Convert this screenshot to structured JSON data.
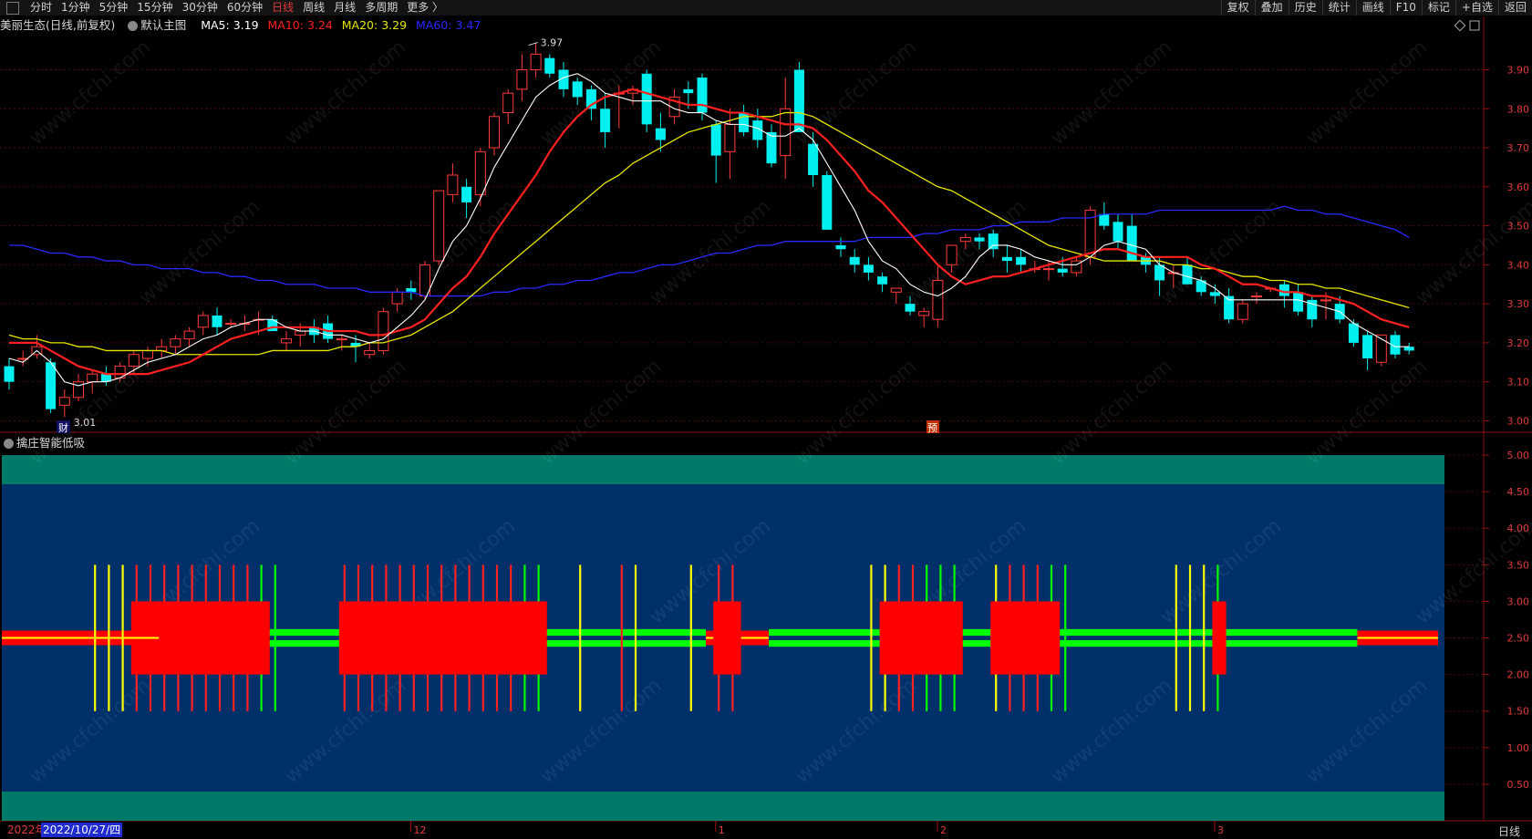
{
  "toolbar": {
    "periods": [
      "分时",
      "1分钟",
      "5分钟",
      "15分钟",
      "30分钟",
      "60分钟",
      "日线",
      "周线",
      "月线",
      "多周期",
      "更多 〉"
    ],
    "active_period": "日线",
    "right_buttons": [
      "复权",
      "叠加",
      "历史",
      "统计",
      "画线",
      "F10",
      "标记",
      "+自选",
      "返回"
    ]
  },
  "info": {
    "stock": "美丽生态(日线,前复权)",
    "template": "默认主图",
    "ma5": "MA5: 3.19",
    "ma10": "MA10: 3.24",
    "ma20": "MA20: 3.29",
    "ma60": "MA60: 3.47",
    "colors": {
      "ma5": "#ffffff",
      "ma10": "#ff2020",
      "ma20": "#e6e600",
      "ma60": "#2020ff"
    }
  },
  "indicator": {
    "title": "擒庄智能低吸"
  },
  "annotations": {
    "high": "3.97",
    "low": "3.01",
    "fin_marker": "财",
    "pre_marker": "预"
  },
  "price_axis": [
    "3.90",
    "3.80",
    "3.70",
    "3.60",
    "3.50",
    "3.40",
    "3.30",
    "3.20",
    "3.10",
    "3.00"
  ],
  "ind_axis": [
    "5.00",
    "4.50",
    "4.00",
    "3.50",
    "3.00",
    "2.50",
    "2.00",
    "1.50",
    "1.00",
    "0.50"
  ],
  "time_axis": {
    "year": "2022年",
    "cursor_date": "2022/10/27/四",
    "months": [
      "12",
      "1",
      "2",
      "3"
    ],
    "period": "日线"
  },
  "watermark": "www.cfchi.com",
  "chart_data": {
    "type": "candlestick",
    "ylim": [
      2.98,
      3.99
    ],
    "indicator_ylim": [
      0,
      5.3
    ],
    "candles": [
      [
        3.14,
        3.16,
        3.08,
        3.1
      ],
      [
        3.16,
        3.18,
        3.14,
        3.16
      ],
      [
        3.17,
        3.22,
        3.16,
        3.19
      ],
      [
        3.15,
        3.16,
        3.02,
        3.03
      ],
      [
        3.04,
        3.08,
        3.01,
        3.06
      ],
      [
        3.06,
        3.12,
        3.05,
        3.1
      ],
      [
        3.1,
        3.13,
        3.07,
        3.12
      ],
      [
        3.12,
        3.14,
        3.09,
        3.1
      ],
      [
        3.11,
        3.15,
        3.1,
        3.14
      ],
      [
        3.14,
        3.18,
        3.12,
        3.17
      ],
      [
        3.16,
        3.19,
        3.14,
        3.18
      ],
      [
        3.18,
        3.21,
        3.16,
        3.19
      ],
      [
        3.19,
        3.22,
        3.17,
        3.21
      ],
      [
        3.21,
        3.24,
        3.19,
        3.23
      ],
      [
        3.24,
        3.28,
        3.22,
        3.27
      ],
      [
        3.27,
        3.29,
        3.22,
        3.24
      ],
      [
        3.25,
        3.26,
        3.24,
        3.25
      ],
      [
        3.25,
        3.27,
        3.23,
        3.25
      ],
      [
        3.26,
        3.28,
        3.22,
        3.26
      ],
      [
        3.26,
        3.27,
        3.23,
        3.23
      ],
      [
        3.2,
        3.23,
        3.18,
        3.21
      ],
      [
        3.22,
        3.25,
        3.19,
        3.23
      ],
      [
        3.24,
        3.26,
        3.2,
        3.22
      ],
      [
        3.25,
        3.27,
        3.2,
        3.21
      ],
      [
        3.21,
        3.22,
        3.18,
        3.21
      ],
      [
        3.2,
        3.22,
        3.15,
        3.19
      ],
      [
        3.17,
        3.2,
        3.16,
        3.18
      ],
      [
        3.18,
        3.29,
        3.17,
        3.28
      ],
      [
        3.3,
        3.34,
        3.28,
        3.33
      ],
      [
        3.34,
        3.36,
        3.31,
        3.33
      ],
      [
        3.32,
        3.41,
        3.31,
        3.4
      ],
      [
        3.41,
        3.59,
        3.4,
        3.59
      ],
      [
        3.58,
        3.66,
        3.56,
        3.63
      ],
      [
        3.6,
        3.62,
        3.52,
        3.56
      ],
      [
        3.58,
        3.7,
        3.55,
        3.69
      ],
      [
        3.7,
        3.79,
        3.68,
        3.78
      ],
      [
        3.79,
        3.85,
        3.76,
        3.84
      ],
      [
        3.85,
        3.94,
        3.82,
        3.9
      ],
      [
        3.9,
        3.97,
        3.88,
        3.94
      ],
      [
        3.93,
        3.94,
        3.88,
        3.89
      ],
      [
        3.9,
        3.92,
        3.83,
        3.85
      ],
      [
        3.87,
        3.88,
        3.81,
        3.83
      ],
      [
        3.85,
        3.86,
        3.77,
        3.8
      ],
      [
        3.8,
        3.84,
        3.7,
        3.74
      ],
      [
        3.84,
        3.86,
        3.75,
        3.84
      ],
      [
        3.84,
        3.86,
        3.81,
        3.85
      ],
      [
        3.89,
        3.9,
        3.74,
        3.76
      ],
      [
        3.75,
        3.79,
        3.69,
        3.72
      ],
      [
        3.78,
        3.85,
        3.76,
        3.83
      ],
      [
        3.85,
        3.87,
        3.8,
        3.84
      ],
      [
        3.88,
        3.89,
        3.77,
        3.79
      ],
      [
        3.76,
        3.77,
        3.61,
        3.68
      ],
      [
        3.69,
        3.8,
        3.62,
        3.76
      ],
      [
        3.79,
        3.81,
        3.73,
        3.74
      ],
      [
        3.77,
        3.8,
        3.7,
        3.72
      ],
      [
        3.74,
        3.76,
        3.65,
        3.66
      ],
      [
        3.68,
        3.88,
        3.62,
        3.8
      ],
      [
        3.9,
        3.92,
        3.74,
        3.74
      ],
      [
        3.71,
        3.74,
        3.6,
        3.63
      ],
      [
        3.63,
        3.64,
        3.5,
        3.49
      ],
      [
        3.45,
        3.47,
        3.42,
        3.44
      ],
      [
        3.42,
        3.44,
        3.38,
        3.4
      ],
      [
        3.4,
        3.42,
        3.36,
        3.38
      ],
      [
        3.37,
        3.38,
        3.33,
        3.35
      ],
      [
        3.33,
        3.34,
        3.3,
        3.34
      ],
      [
        3.3,
        3.32,
        3.27,
        3.28
      ],
      [
        3.27,
        3.29,
        3.24,
        3.28
      ],
      [
        3.26,
        3.4,
        3.24,
        3.36
      ],
      [
        3.4,
        3.45,
        3.38,
        3.45
      ],
      [
        3.46,
        3.48,
        3.44,
        3.47
      ],
      [
        3.47,
        3.48,
        3.44,
        3.46
      ],
      [
        3.48,
        3.49,
        3.42,
        3.44
      ],
      [
        3.42,
        3.45,
        3.38,
        3.41
      ],
      [
        3.42,
        3.44,
        3.38,
        3.4
      ],
      [
        3.39,
        3.41,
        3.38,
        3.39
      ],
      [
        3.39,
        3.41,
        3.36,
        3.39
      ],
      [
        3.39,
        3.42,
        3.37,
        3.38
      ],
      [
        3.38,
        3.42,
        3.37,
        3.41
      ],
      [
        3.42,
        3.55,
        3.4,
        3.54
      ],
      [
        3.53,
        3.56,
        3.49,
        3.5
      ],
      [
        3.51,
        3.53,
        3.44,
        3.46
      ],
      [
        3.5,
        3.53,
        3.43,
        3.41
      ],
      [
        3.42,
        3.43,
        3.38,
        3.4
      ],
      [
        3.4,
        3.42,
        3.32,
        3.36
      ],
      [
        3.38,
        3.4,
        3.34,
        3.38
      ],
      [
        3.4,
        3.42,
        3.35,
        3.35
      ],
      [
        3.36,
        3.37,
        3.32,
        3.33
      ],
      [
        3.33,
        3.35,
        3.3,
        3.32
      ],
      [
        3.32,
        3.34,
        3.25,
        3.26
      ],
      [
        3.26,
        3.31,
        3.25,
        3.3
      ],
      [
        3.32,
        3.33,
        3.3,
        3.32
      ],
      [
        3.34,
        3.34,
        3.33,
        3.34
      ],
      [
        3.35,
        3.36,
        3.29,
        3.32
      ],
      [
        3.33,
        3.35,
        3.27,
        3.28
      ],
      [
        3.31,
        3.32,
        3.24,
        3.26
      ],
      [
        3.31,
        3.33,
        3.26,
        3.31
      ],
      [
        3.3,
        3.32,
        3.25,
        3.26
      ],
      [
        3.25,
        3.26,
        3.19,
        3.2
      ],
      [
        3.22,
        3.23,
        3.13,
        3.16
      ],
      [
        3.15,
        3.22,
        3.14,
        3.22
      ],
      [
        3.22,
        3.23,
        3.16,
        3.17
      ],
      [
        3.19,
        3.2,
        3.17,
        3.18
      ]
    ],
    "ma5": [
      3.16,
      3.15,
      3.18,
      3.15,
      3.1,
      3.09,
      3.1,
      3.1,
      3.11,
      3.13,
      3.15,
      3.16,
      3.17,
      3.19,
      3.21,
      3.22,
      3.24,
      3.25,
      3.26,
      3.26,
      3.24,
      3.23,
      3.23,
      3.22,
      3.22,
      3.21,
      3.2,
      3.21,
      3.24,
      3.27,
      3.31,
      3.39,
      3.46,
      3.5,
      3.57,
      3.65,
      3.71,
      3.77,
      3.83,
      3.86,
      3.88,
      3.89,
      3.87,
      3.84,
      3.83,
      3.82,
      3.82,
      3.82,
      3.8,
      3.79,
      3.79,
      3.77,
      3.76,
      3.76,
      3.75,
      3.73,
      3.73,
      3.75,
      3.72,
      3.66,
      3.6,
      3.54,
      3.46,
      3.41,
      3.39,
      3.35,
      3.33,
      3.32,
      3.34,
      3.37,
      3.42,
      3.45,
      3.45,
      3.44,
      3.42,
      3.41,
      3.4,
      3.4,
      3.42,
      3.45,
      3.46,
      3.45,
      3.44,
      3.4,
      3.38,
      3.37,
      3.36,
      3.34,
      3.31,
      3.31,
      3.31,
      3.31,
      3.31,
      3.31,
      3.3,
      3.29,
      3.28,
      3.25,
      3.23,
      3.21,
      3.19,
      3.19
    ],
    "ma10": [
      3.2,
      3.2,
      3.2,
      3.18,
      3.16,
      3.14,
      3.13,
      3.12,
      3.12,
      3.12,
      3.12,
      3.13,
      3.14,
      3.15,
      3.17,
      3.19,
      3.21,
      3.22,
      3.23,
      3.24,
      3.24,
      3.24,
      3.24,
      3.23,
      3.23,
      3.23,
      3.22,
      3.22,
      3.23,
      3.24,
      3.26,
      3.3,
      3.34,
      3.37,
      3.42,
      3.48,
      3.53,
      3.58,
      3.63,
      3.69,
      3.74,
      3.78,
      3.81,
      3.83,
      3.84,
      3.85,
      3.84,
      3.83,
      3.82,
      3.81,
      3.81,
      3.8,
      3.79,
      3.79,
      3.78,
      3.77,
      3.76,
      3.76,
      3.75,
      3.72,
      3.68,
      3.64,
      3.59,
      3.56,
      3.52,
      3.48,
      3.44,
      3.4,
      3.37,
      3.35,
      3.36,
      3.37,
      3.37,
      3.38,
      3.39,
      3.4,
      3.41,
      3.42,
      3.43,
      3.44,
      3.44,
      3.43,
      3.42,
      3.42,
      3.42,
      3.42,
      3.4,
      3.39,
      3.37,
      3.35,
      3.35,
      3.34,
      3.33,
      3.33,
      3.32,
      3.32,
      3.31,
      3.3,
      3.28,
      3.26,
      3.25,
      3.24
    ],
    "ma20": [
      3.22,
      3.21,
      3.21,
      3.2,
      3.2,
      3.19,
      3.19,
      3.18,
      3.18,
      3.18,
      3.18,
      3.18,
      3.17,
      3.17,
      3.17,
      3.17,
      3.17,
      3.17,
      3.17,
      3.18,
      3.18,
      3.18,
      3.18,
      3.18,
      3.19,
      3.19,
      3.2,
      3.2,
      3.21,
      3.22,
      3.24,
      3.26,
      3.28,
      3.31,
      3.34,
      3.37,
      3.4,
      3.43,
      3.46,
      3.49,
      3.52,
      3.55,
      3.58,
      3.61,
      3.63,
      3.66,
      3.68,
      3.7,
      3.72,
      3.74,
      3.75,
      3.76,
      3.77,
      3.78,
      3.78,
      3.78,
      3.79,
      3.79,
      3.78,
      3.76,
      3.74,
      3.72,
      3.7,
      3.68,
      3.66,
      3.64,
      3.62,
      3.6,
      3.59,
      3.57,
      3.55,
      3.53,
      3.51,
      3.49,
      3.47,
      3.45,
      3.44,
      3.43,
      3.42,
      3.41,
      3.41,
      3.41,
      3.41,
      3.41,
      3.4,
      3.4,
      3.39,
      3.39,
      3.38,
      3.37,
      3.37,
      3.36,
      3.36,
      3.35,
      3.35,
      3.34,
      3.34,
      3.33,
      3.32,
      3.31,
      3.3,
      3.29
    ],
    "ma60": [
      3.45,
      3.45,
      3.44,
      3.43,
      3.43,
      3.42,
      3.42,
      3.41,
      3.41,
      3.4,
      3.4,
      3.39,
      3.39,
      3.39,
      3.38,
      3.38,
      3.37,
      3.37,
      3.36,
      3.36,
      3.35,
      3.35,
      3.35,
      3.34,
      3.34,
      3.34,
      3.33,
      3.33,
      3.33,
      3.33,
      3.32,
      3.32,
      3.32,
      3.32,
      3.32,
      3.33,
      3.33,
      3.34,
      3.34,
      3.35,
      3.35,
      3.36,
      3.36,
      3.37,
      3.38,
      3.38,
      3.39,
      3.4,
      3.4,
      3.41,
      3.42,
      3.43,
      3.43,
      3.44,
      3.45,
      3.45,
      3.46,
      3.46,
      3.46,
      3.46,
      3.46,
      3.46,
      3.47,
      3.47,
      3.47,
      3.47,
      3.48,
      3.48,
      3.49,
      3.49,
      3.49,
      3.5,
      3.5,
      3.51,
      3.51,
      3.51,
      3.52,
      3.52,
      3.52,
      3.53,
      3.53,
      3.53,
      3.53,
      3.54,
      3.54,
      3.54,
      3.54,
      3.54,
      3.54,
      3.54,
      3.54,
      3.54,
      3.55,
      3.54,
      3.54,
      3.53,
      3.53,
      3.52,
      3.51,
      3.5,
      3.49,
      3.47
    ],
    "signal_lines": [
      [
        6,
        "yellow"
      ],
      [
        7,
        "yellow"
      ],
      [
        8,
        "yellow"
      ],
      [
        9,
        "red"
      ],
      [
        10,
        "red"
      ],
      [
        11,
        "red"
      ],
      [
        12,
        "red"
      ],
      [
        13,
        "red"
      ],
      [
        14,
        "red"
      ],
      [
        15,
        "red"
      ],
      [
        16,
        "red"
      ],
      [
        17,
        "red"
      ],
      [
        18,
        "green"
      ],
      [
        19,
        "green"
      ],
      [
        24,
        "red"
      ],
      [
        25,
        "red"
      ],
      [
        26,
        "red"
      ],
      [
        27,
        "red"
      ],
      [
        28,
        "red"
      ],
      [
        29,
        "red"
      ],
      [
        30,
        "red"
      ],
      [
        31,
        "red"
      ],
      [
        32,
        "red"
      ],
      [
        33,
        "red"
      ],
      [
        34,
        "red"
      ],
      [
        35,
        "red"
      ],
      [
        36,
        "red"
      ],
      [
        37,
        "green"
      ],
      [
        38,
        "green"
      ],
      [
        41,
        "yellow"
      ],
      [
        44,
        "red"
      ],
      [
        45,
        "yellow"
      ],
      [
        49,
        "yellow"
      ],
      [
        51,
        "red"
      ],
      [
        52,
        "red"
      ],
      [
        62,
        "yellow"
      ],
      [
        63,
        "yellow"
      ],
      [
        64,
        "red"
      ],
      [
        65,
        "red"
      ],
      [
        66,
        "green"
      ],
      [
        67,
        "green"
      ],
      [
        68,
        "green"
      ],
      [
        71,
        "yellow"
      ],
      [
        72,
        "red"
      ],
      [
        73,
        "red"
      ],
      [
        74,
        "red"
      ],
      [
        75,
        "green"
      ],
      [
        76,
        "green"
      ],
      [
        84,
        "yellow"
      ],
      [
        85,
        "yellow"
      ],
      [
        86,
        "yellow"
      ],
      [
        87,
        "green"
      ]
    ],
    "red_blocks": [
      [
        9,
        19
      ],
      [
        24,
        39
      ],
      [
        51,
        53
      ],
      [
        63,
        69
      ],
      [
        71,
        76
      ],
      [
        87,
        88
      ]
    ],
    "green_bands": [
      [
        11,
        50
      ],
      [
        55,
        72
      ],
      [
        75,
        97
      ]
    ]
  }
}
